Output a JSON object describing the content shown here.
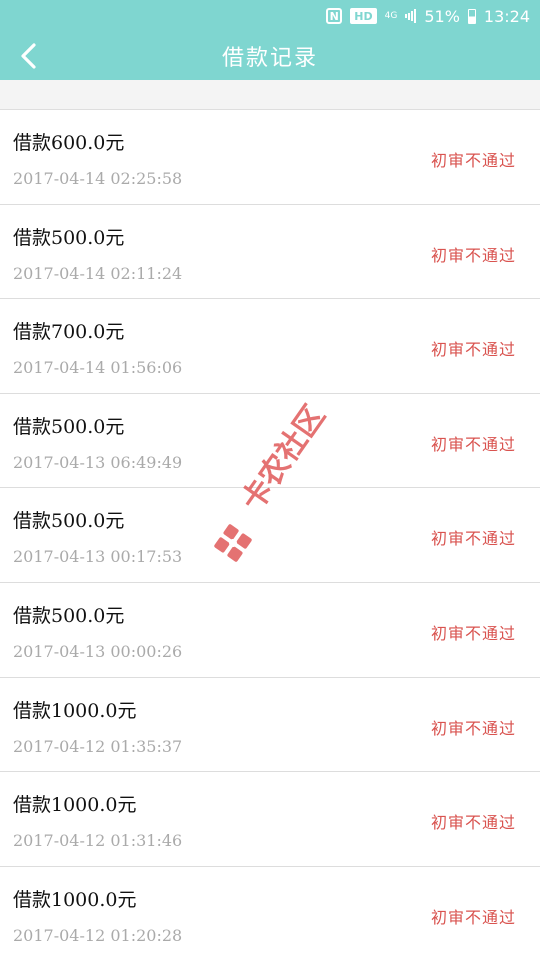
{
  "status_bar": {
    "nfc": "N",
    "hd": "HD",
    "network": "4G",
    "battery": "51%",
    "time": "13:24"
  },
  "header": {
    "title": "借款记录",
    "back_icon": "chevron-left-icon"
  },
  "records": [
    {
      "amount": "借款600.0元",
      "time": "2017-04-14 02:25:58",
      "status": "初审不通过"
    },
    {
      "amount": "借款500.0元",
      "time": "2017-04-14 02:11:24",
      "status": "初审不通过"
    },
    {
      "amount": "借款700.0元",
      "time": "2017-04-14 01:56:06",
      "status": "初审不通过"
    },
    {
      "amount": "借款500.0元",
      "time": "2017-04-13 06:49:49",
      "status": "初审不通过"
    },
    {
      "amount": "借款500.0元",
      "time": "2017-04-13 00:17:53",
      "status": "初审不通过"
    },
    {
      "amount": "借款500.0元",
      "time": "2017-04-13 00:00:26",
      "status": "初审不通过"
    },
    {
      "amount": "借款1000.0元",
      "time": "2017-04-12 01:35:37",
      "status": "初审不通过"
    },
    {
      "amount": "借款1000.0元",
      "time": "2017-04-12 01:31:46",
      "status": "初审不通过"
    },
    {
      "amount": "借款1000.0元",
      "time": "2017-04-12 01:20:28",
      "status": "初审不通过"
    }
  ],
  "watermark": {
    "text": "卡农社区",
    "color": "#e05a5a"
  },
  "colors": {
    "accent": "#7fd6d0",
    "status_red": "#d9534f",
    "secondary_text": "#aaaaaa"
  }
}
